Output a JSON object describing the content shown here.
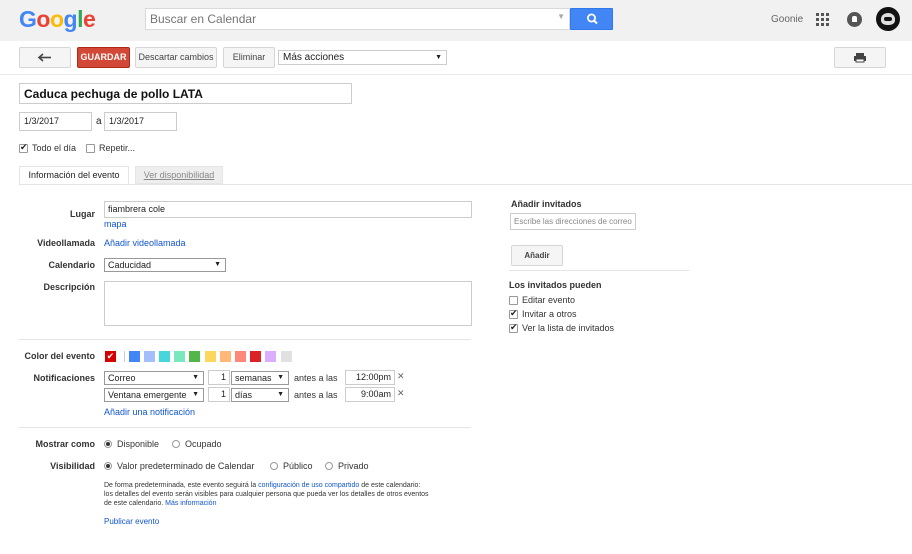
{
  "header": {
    "logo": "Google",
    "search_placeholder": "Buscar en Calendar",
    "user_name": "Goonie"
  },
  "toolbar": {
    "back_icon": "back-arrow-icon",
    "save_label": "GUARDAR",
    "discard_label": "Descartar cambios",
    "delete_label": "Eliminar",
    "more_actions_label": "Más acciones",
    "print_icon": "print-icon"
  },
  "event": {
    "title": "Caduca pechuga de pollo LATA",
    "start_date": "1/3/2017",
    "to_label": "a",
    "end_date": "1/3/2017",
    "all_day_label": "Todo el día",
    "all_day_checked": true,
    "repeat_label": "Repetir...",
    "repeat_checked": false
  },
  "tabs": {
    "info_label": "Información del evento",
    "availability_label": "Ver disponibilidad"
  },
  "form": {
    "location_label": "Lugar",
    "location_value": "fiambrera cole",
    "map_link": "mapa",
    "video_label": "Videollamada",
    "video_link": "Añadir videollamada",
    "calendar_label": "Calendario",
    "calendar_value": "Caducidad",
    "description_label": "Descripción",
    "description_value": "",
    "color_label": "Color del evento",
    "colors": [
      "#d50000",
      "#4285f4",
      "#a4bdfc",
      "#46d6db",
      "#7ae7bf",
      "#51b749",
      "#fbd75b",
      "#ffb878",
      "#ff887c",
      "#dc2127",
      "#dbadff",
      "#e1e1e1"
    ],
    "notifications_label": "Notificaciones",
    "notifications": [
      {
        "method": "Correo",
        "amount": "1",
        "unit": "semanas",
        "before": "antes a las",
        "time": "12:00pm"
      },
      {
        "method": "Ventana emergente",
        "amount": "1",
        "unit": "días",
        "before": "antes a las",
        "time": "9:00am"
      }
    ],
    "add_notification_link": "Añadir una notificación",
    "show_as_label": "Mostrar como",
    "show_as_available": "Disponible",
    "show_as_busy": "Ocupado",
    "visibility_label": "Visibilidad",
    "visibility_default": "Valor predeterminado de Calendar",
    "visibility_public": "Público",
    "visibility_private": "Privado",
    "note_line1_a": "De forma predeterminada, este evento seguirá la",
    "note_line1_link": "configuración de uso compartido",
    "note_line1_b": "de este calendario:",
    "note_line2": "los detalles del evento serán visibles para cualquier persona que pueda ver los detalles de otros eventos",
    "note_line3": "de este calendario.",
    "note_more_link": "Más información",
    "publish_link": "Publicar evento"
  },
  "guests": {
    "title": "Añadir invitados",
    "input_placeholder": "Escribe las direcciones de correo",
    "add_button": "Añadir",
    "permissions_title": "Los invitados pueden",
    "permissions": [
      {
        "label": "Editar evento",
        "checked": false
      },
      {
        "label": "Invitar a otros",
        "checked": true
      },
      {
        "label": "Ver la lista de invitados",
        "checked": true
      }
    ]
  }
}
